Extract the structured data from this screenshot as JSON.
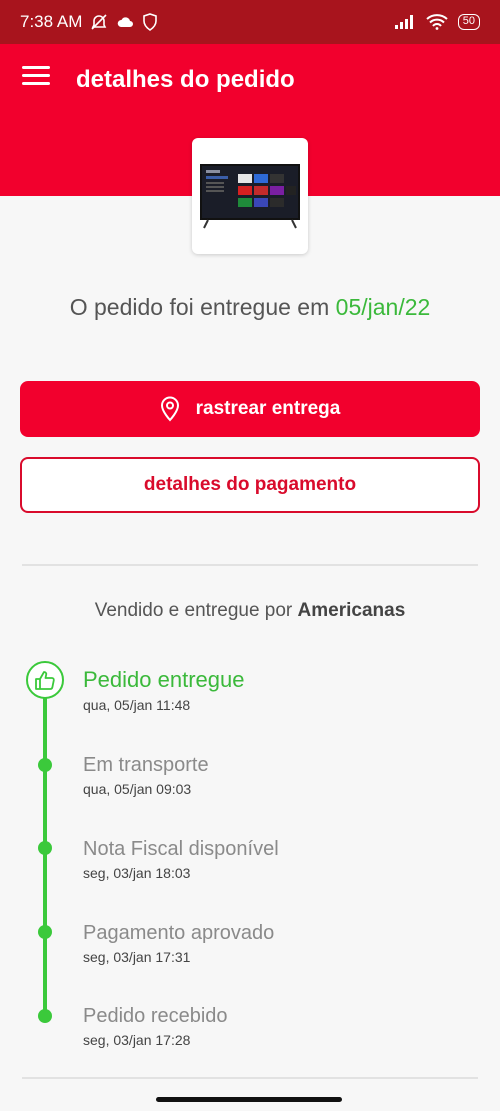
{
  "status_bar": {
    "time": "7:38 AM",
    "battery": "50"
  },
  "header": {
    "title": "detalhes do pedido"
  },
  "delivery": {
    "message": "O pedido foi entregue em ",
    "date": "05/jan/22"
  },
  "actions": {
    "track_label": "rastrear entrega",
    "payment_label": "detalhes do pagamento"
  },
  "seller": {
    "prefix": "Vendido e entregue por ",
    "name": "Americanas"
  },
  "colors": {
    "brand_red": "#f2002d",
    "success_green": "#3bb93b"
  },
  "timeline": [
    {
      "title": "Pedido entregue",
      "time": "qua, 05/jan 11:48",
      "active": true,
      "icon": "thumbs-up-icon"
    },
    {
      "title": "Em transporte",
      "time": "qua, 05/jan 09:03",
      "active": false
    },
    {
      "title": "Nota Fiscal disponível",
      "time": "seg, 03/jan 18:03",
      "active": false
    },
    {
      "title": "Pagamento aprovado",
      "time": "seg, 03/jan 17:31",
      "active": false
    },
    {
      "title": "Pedido recebido",
      "time": "seg, 03/jan 17:28",
      "active": false
    }
  ]
}
